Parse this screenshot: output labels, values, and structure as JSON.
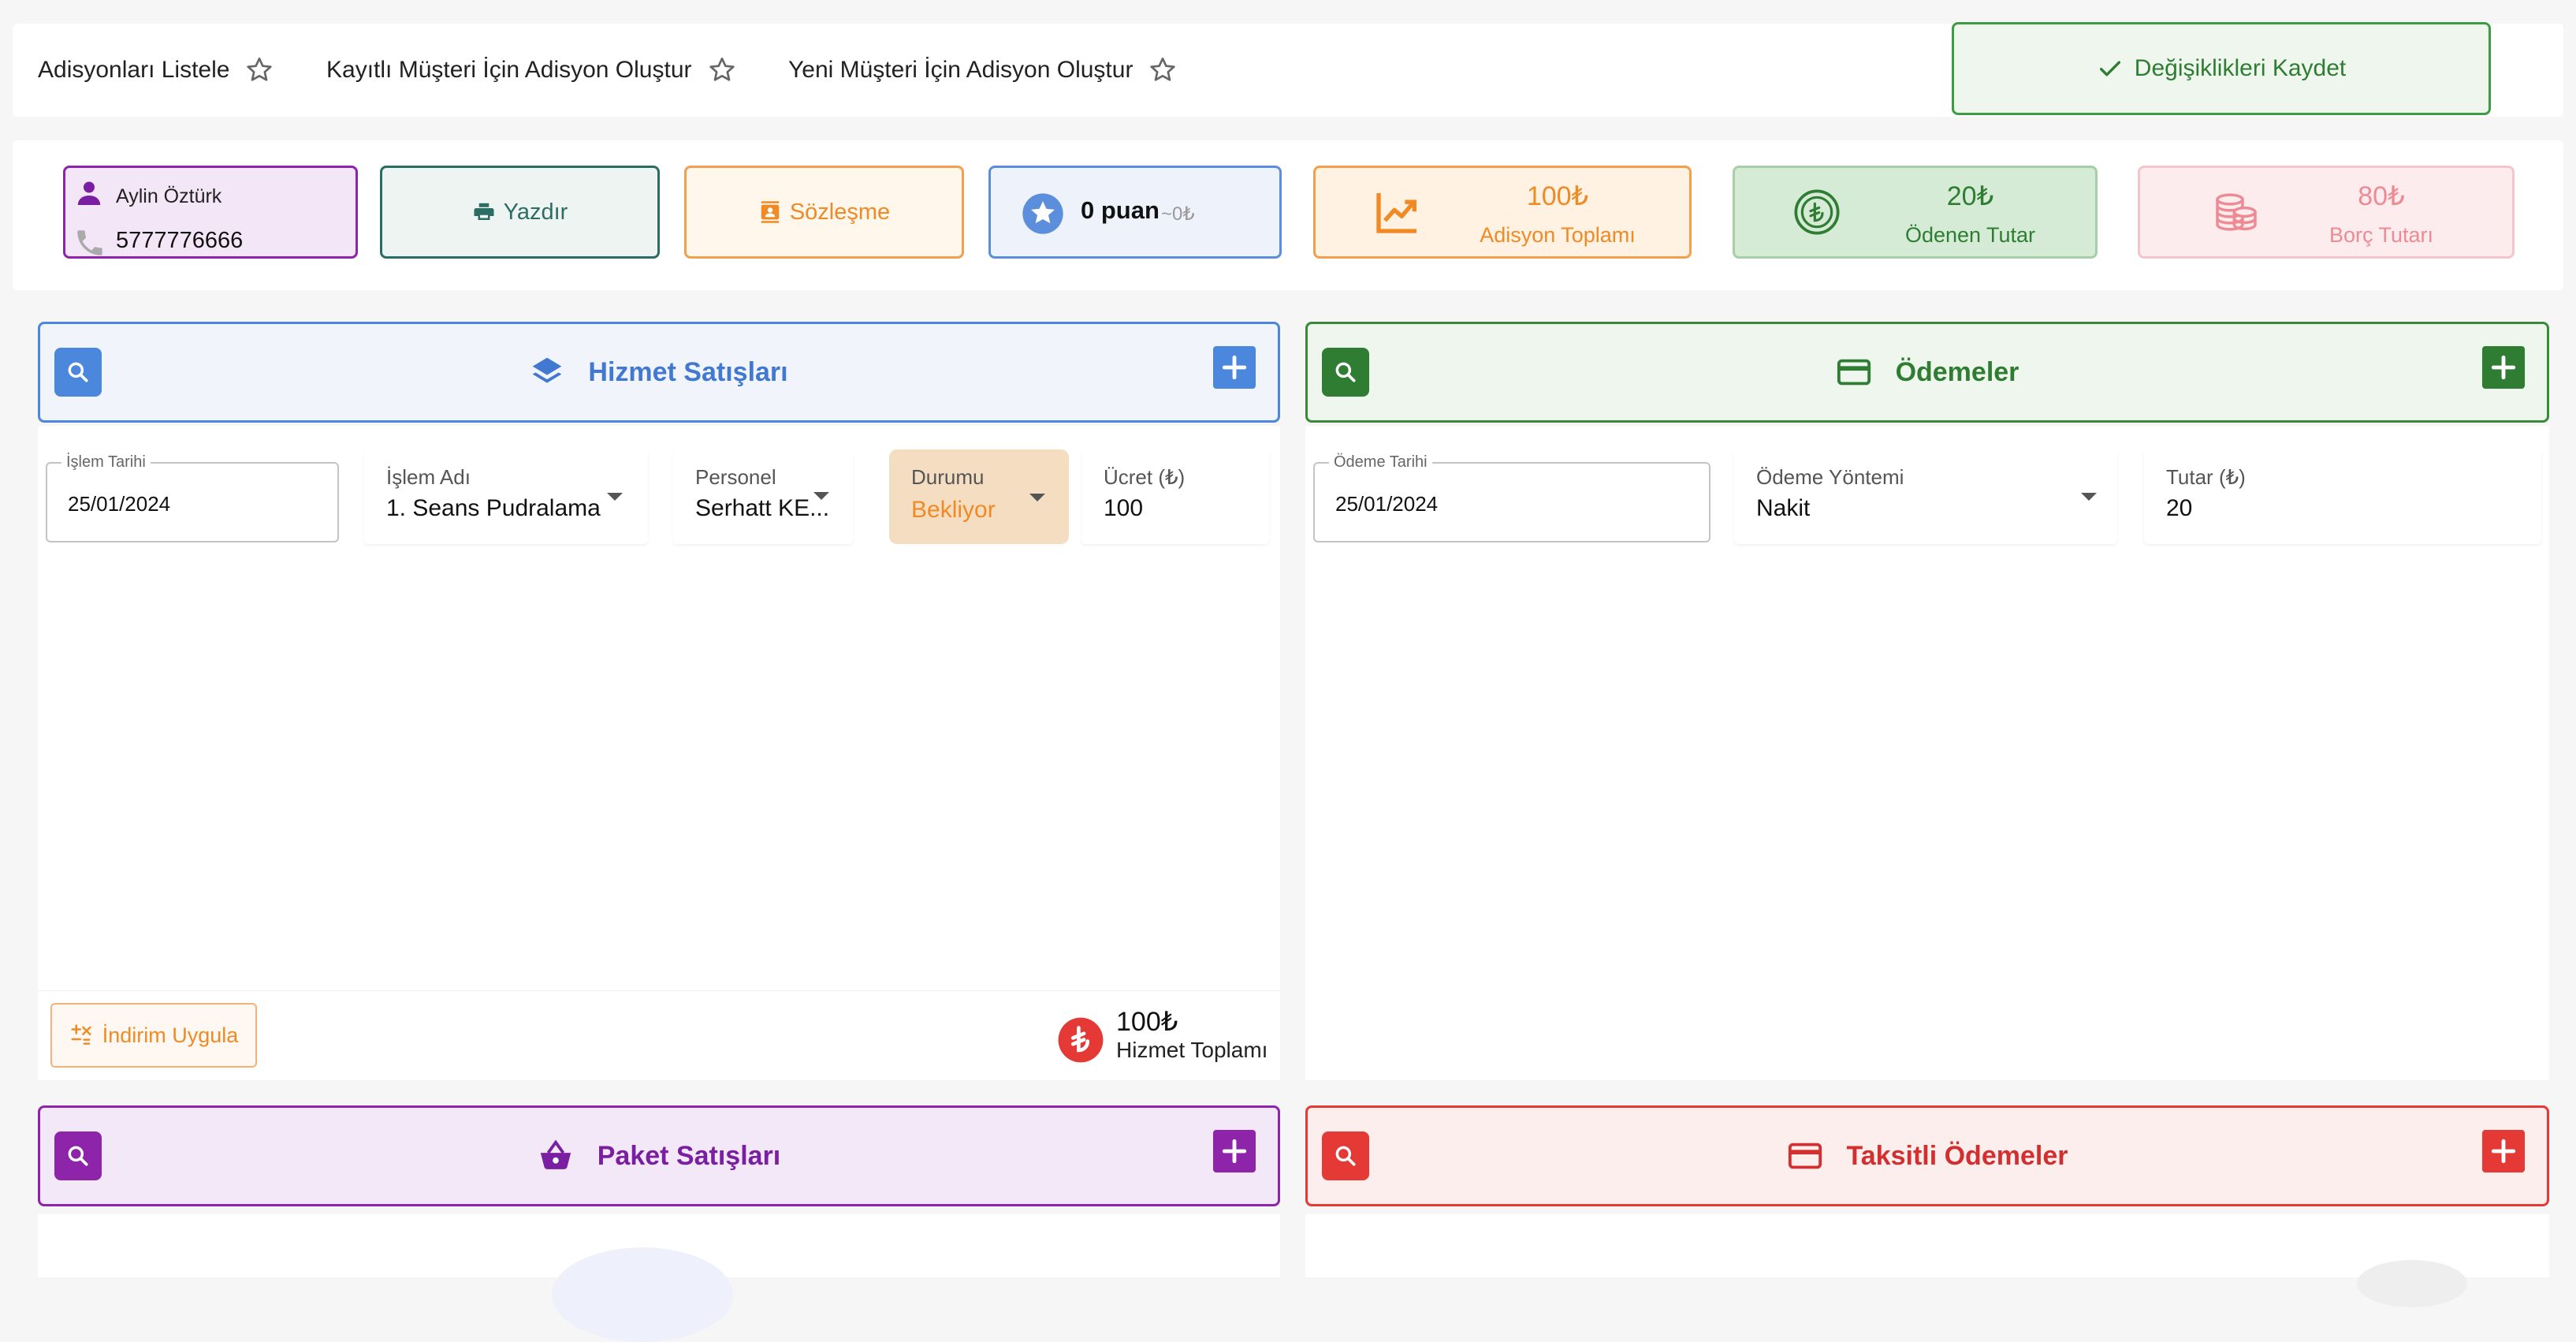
{
  "nav": {
    "items": [
      {
        "label": "Adisyonları Listele",
        "icon": "star-outline-icon"
      },
      {
        "label": "Kayıtlı Müşteri İçin Adisyon Oluştur",
        "icon": "star-outline-icon"
      },
      {
        "label": "Yeni Müşteri İçin Adisyon Oluştur",
        "icon": "star-outline-icon"
      }
    ],
    "save_label": "Değişiklikleri Kaydet"
  },
  "customer": {
    "name": "Aylin Öztürk",
    "phone": "5777776666"
  },
  "actions": {
    "print_label": "Yazdır",
    "contract_label": "Sözleşme"
  },
  "points": {
    "value": "0 puan",
    "sub": "~0₺"
  },
  "totals": {
    "bill_total": {
      "value": "100₺",
      "label": "Adisyon Toplamı"
    },
    "paid": {
      "value": "20₺",
      "label": "Ödenen Tutar"
    },
    "debt": {
      "value": "80₺",
      "label": "Borç Tutarı"
    }
  },
  "services": {
    "title": "Hizmet Satışları",
    "row": {
      "date_label": "İşlem Tarihi",
      "date": "25/01/2024",
      "name_label": "İşlem Adı",
      "name": "1. Seans Pudralama",
      "staff_label": "Personel",
      "staff": "Serhatt KE...",
      "status_label": "Durumu",
      "status": "Bekliyor",
      "fee_label": "Ücret (₺)",
      "fee": "100"
    },
    "discount_label": "İndirim Uygula",
    "total_value": "100₺",
    "total_label": "Hizmet Toplamı"
  },
  "payments": {
    "title": "Ödemeler",
    "row": {
      "date_label": "Ödeme Tarihi",
      "date": "25/01/2024",
      "method_label": "Ödeme Yöntemi",
      "method": "Nakit",
      "amount_label": "Tutar (₺)",
      "amount": "20"
    }
  },
  "packages": {
    "title": "Paket Satışları"
  },
  "installments": {
    "title": "Taksitli Ödemeler"
  },
  "colors": {
    "blue": "#4a87dd",
    "green": "#2e7d32",
    "purple": "#8e24aa",
    "red": "#e53935",
    "orange": "#ef8a24"
  }
}
